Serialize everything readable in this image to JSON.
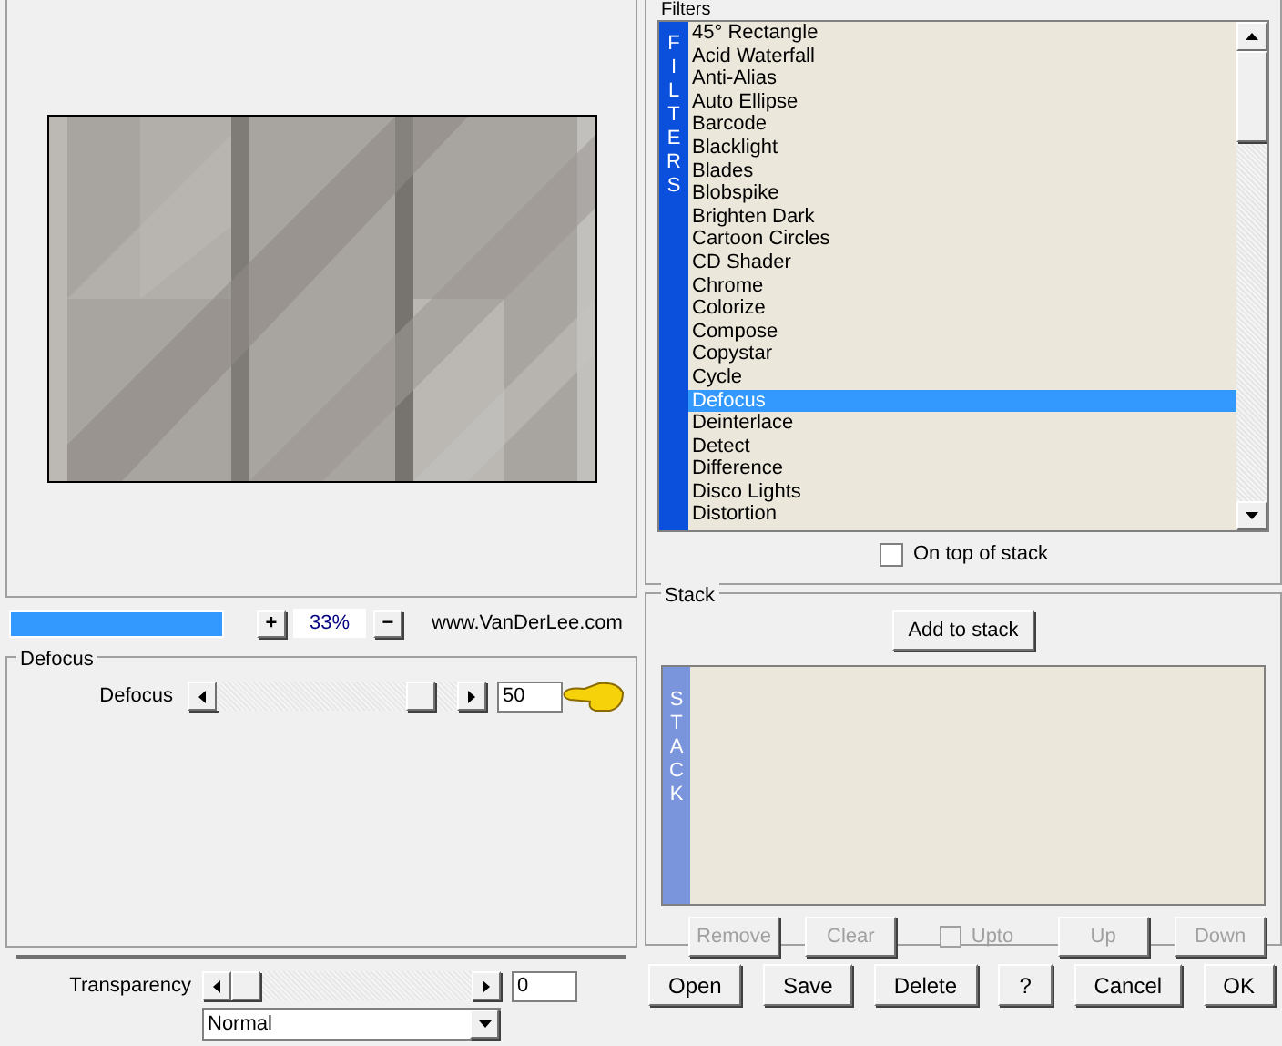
{
  "zoom": {
    "level": 1.0,
    "in_label": "+",
    "value": "33%",
    "out_label": "−",
    "link": "www.VanDerLee.com"
  },
  "filter_group": {
    "title": "Defocus",
    "sliders": [
      {
        "label": "Defocus",
        "level": 0.9,
        "value": "50",
        "pointer": true
      }
    ]
  },
  "transparency": {
    "label": "Transparency",
    "level": 0,
    "value": "0",
    "blend_mode": "Normal"
  },
  "filters": {
    "title": "Filters",
    "band": "FILTERS",
    "items": [
      {
        "label": "45° Rectangle",
        "selected": false
      },
      {
        "label": "Acid Waterfall",
        "selected": false
      },
      {
        "label": "Anti-Alias",
        "selected": false
      },
      {
        "label": "Auto Ellipse",
        "selected": false
      },
      {
        "label": "Barcode",
        "selected": false
      },
      {
        "label": "Blacklight",
        "selected": false
      },
      {
        "label": "Blades",
        "selected": false
      },
      {
        "label": "Blobspike",
        "selected": false
      },
      {
        "label": "Brighten Dark",
        "selected": false
      },
      {
        "label": "Cartoon Circles",
        "selected": false
      },
      {
        "label": "CD Shader",
        "selected": false
      },
      {
        "label": "Chrome",
        "selected": false
      },
      {
        "label": "Colorize",
        "selected": false
      },
      {
        "label": "Compose",
        "selected": false
      },
      {
        "label": "Copystar",
        "selected": false
      },
      {
        "label": "Cycle",
        "selected": false
      },
      {
        "label": "Defocus",
        "selected": true
      },
      {
        "label": "Deinterlace",
        "selected": false
      },
      {
        "label": "Detect",
        "selected": false
      },
      {
        "label": "Difference",
        "selected": false
      },
      {
        "label": "Disco Lights",
        "selected": false
      },
      {
        "label": "Distortion",
        "selected": false
      }
    ],
    "on_top": {
      "label": "On top of stack",
      "checked": false
    }
  },
  "stack": {
    "title": "Stack",
    "add_label": "Add to stack",
    "band": "STACK",
    "controls": [
      {
        "kind": "button",
        "label": "Remove",
        "disabled": true
      },
      {
        "kind": "button",
        "label": "Clear",
        "disabled": true
      },
      {
        "kind": "checkbox",
        "label": "Upto",
        "disabled": true,
        "checked": false
      },
      {
        "kind": "button",
        "label": "Up",
        "disabled": true
      },
      {
        "kind": "button",
        "label": "Down",
        "disabled": true
      }
    ]
  },
  "buttons": [
    {
      "label": "Open"
    },
    {
      "label": "Save"
    },
    {
      "label": "Delete"
    },
    {
      "label": "?"
    },
    {
      "label": "Cancel"
    },
    {
      "label": "OK"
    }
  ]
}
